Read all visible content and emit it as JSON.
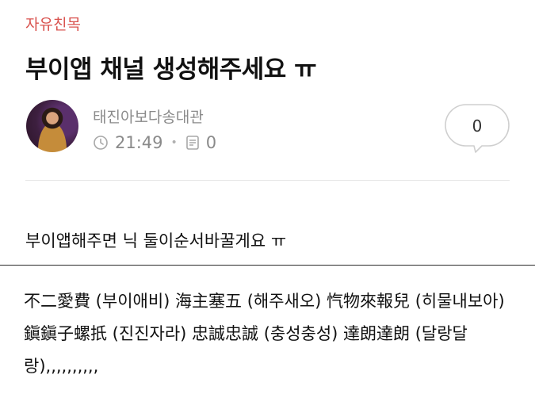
{
  "post": {
    "category": "자유친목",
    "title": "부이앱 채널 생성해주세요 ㅠ",
    "author": "태진아보다송대관",
    "time": "21:49",
    "comment_count": "0",
    "like_count": "0"
  },
  "content": {
    "line1": "부이앱해주면 닉 둘이순서바꿀게요 ㅠ",
    "paragraph": "不二愛費 (부이애비) 海主塞五 (해주새오) 忾物來報兒 (히물내보아) 鎭鎭子螺扺 (진진자라) 忠誠忠誠 (충성충성) 達朗達朗 (달랑달랑),,,,,,,,,,"
  },
  "icons": {
    "clock": "clock-icon",
    "comment": "comment-list-icon",
    "bubble": "speech-bubble-icon"
  },
  "colors": {
    "category": "#d9534f",
    "meta": "#8a8a8a"
  }
}
